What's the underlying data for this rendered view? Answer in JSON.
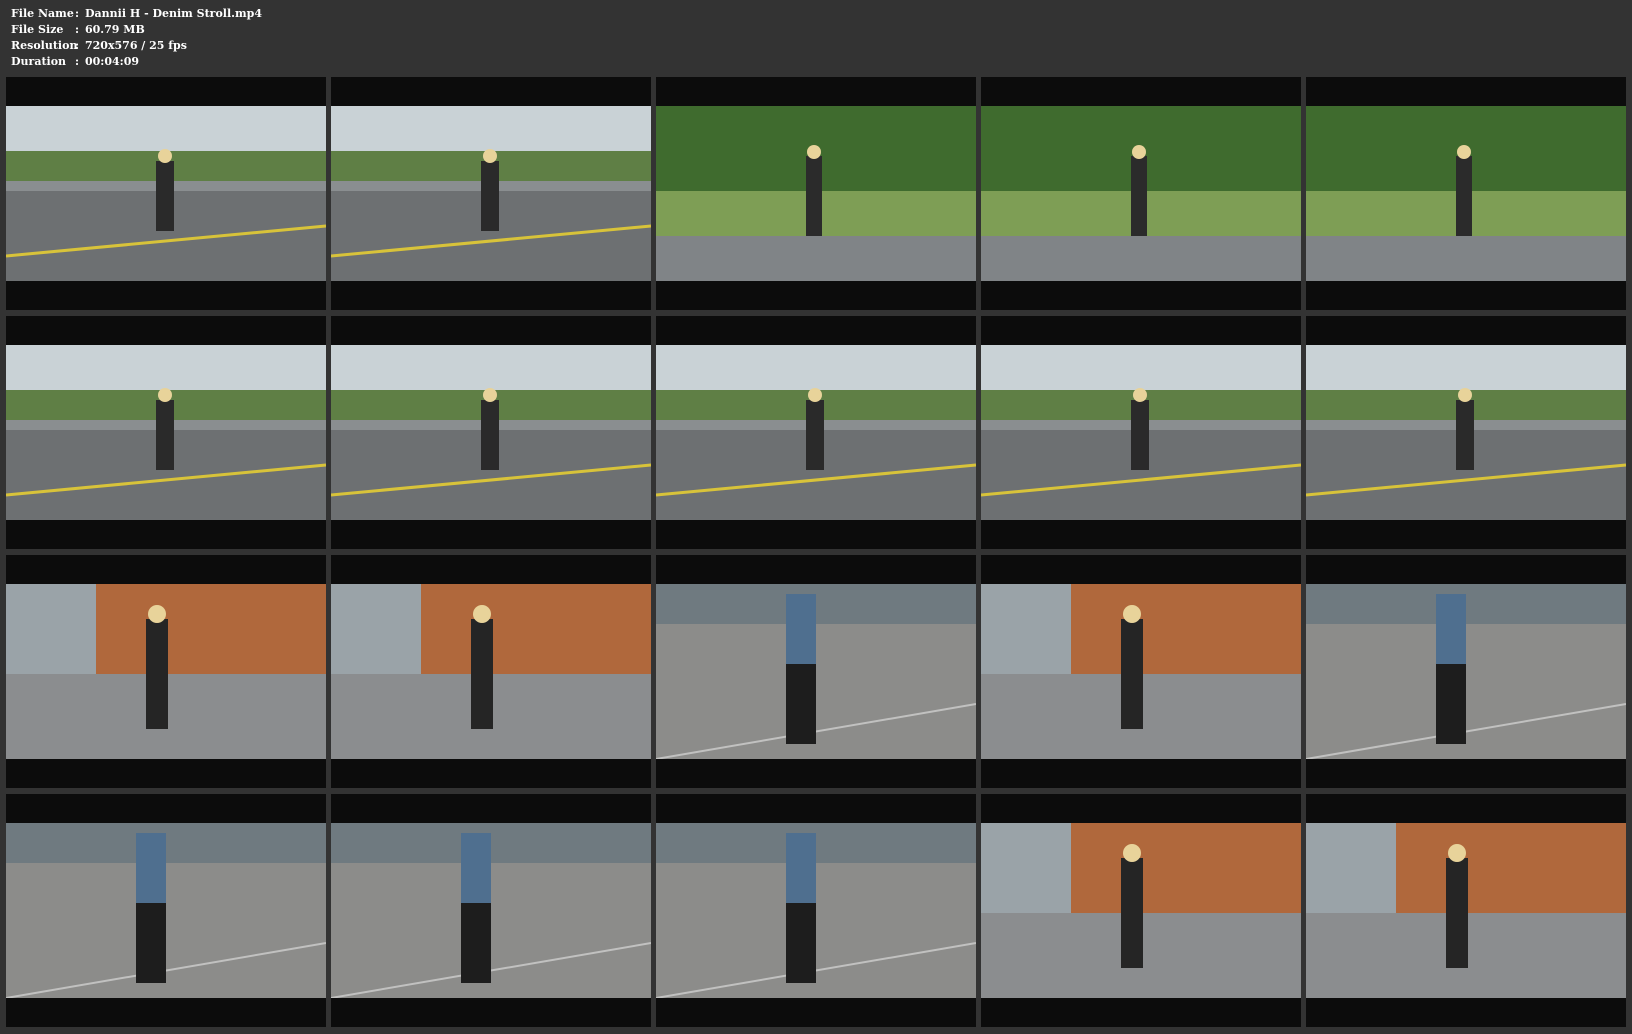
{
  "file_info": {
    "name_label": "File Name",
    "name_value": "Dannii H - Denim Stroll.mp4",
    "size_label": "File Size",
    "size_value": "60.79 MB",
    "resolution_label": "Resolution",
    "resolution_value": "720x576 / 25 fps",
    "duration_label": "Duration",
    "duration_value": "00:04:09",
    "separator": ":"
  },
  "thumbnails": [
    {
      "scene": "road"
    },
    {
      "scene": "road"
    },
    {
      "scene": "park"
    },
    {
      "scene": "park"
    },
    {
      "scene": "park"
    },
    {
      "scene": "road"
    },
    {
      "scene": "road"
    },
    {
      "scene": "road"
    },
    {
      "scene": "road"
    },
    {
      "scene": "road"
    },
    {
      "scene": "building"
    },
    {
      "scene": "building"
    },
    {
      "scene": "pavement"
    },
    {
      "scene": "building"
    },
    {
      "scene": "pavement"
    },
    {
      "scene": "pavement"
    },
    {
      "scene": "pavement"
    },
    {
      "scene": "pavement"
    },
    {
      "scene": "building"
    },
    {
      "scene": "building"
    }
  ]
}
